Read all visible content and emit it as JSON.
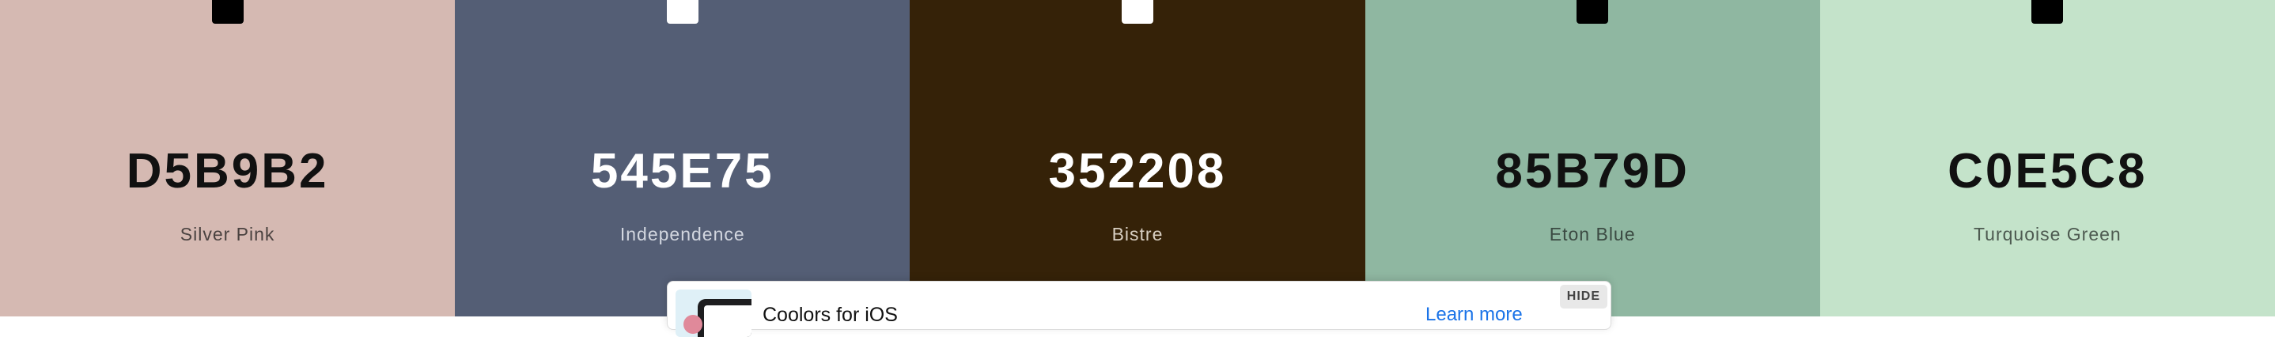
{
  "palette": {
    "swatches": [
      {
        "hex": "D5B9B2",
        "name": "Silver Pink",
        "background": "#D5B9B2",
        "text_color": "#111111",
        "name_color": "#4a4240",
        "lock_color": "#000000"
      },
      {
        "hex": "545E75",
        "name": "Independence",
        "background": "#545E75",
        "text_color": "#ffffff",
        "name_color": "#d2d6df",
        "lock_color": "#ffffff"
      },
      {
        "hex": "352208",
        "name": "Bistre",
        "background": "#352208",
        "text_color": "#ffffff",
        "name_color": "#d8cfc2",
        "lock_color": "#ffffff"
      },
      {
        "hex": "85B79D",
        "name": "Eton Blue",
        "background": "#8FB7A1",
        "text_color": "#111111",
        "name_color": "#3b4a42",
        "lock_color": "#000000"
      },
      {
        "hex": "C0E5C8",
        "name": "Turquoise Green",
        "background": "#C4E3CA",
        "text_color": "#111111",
        "name_color": "#4d5a50",
        "lock_color": "#000000"
      }
    ]
  },
  "ad": {
    "title": "Coolors for iOS",
    "link": "Learn more",
    "hide_label": "HIDE"
  }
}
